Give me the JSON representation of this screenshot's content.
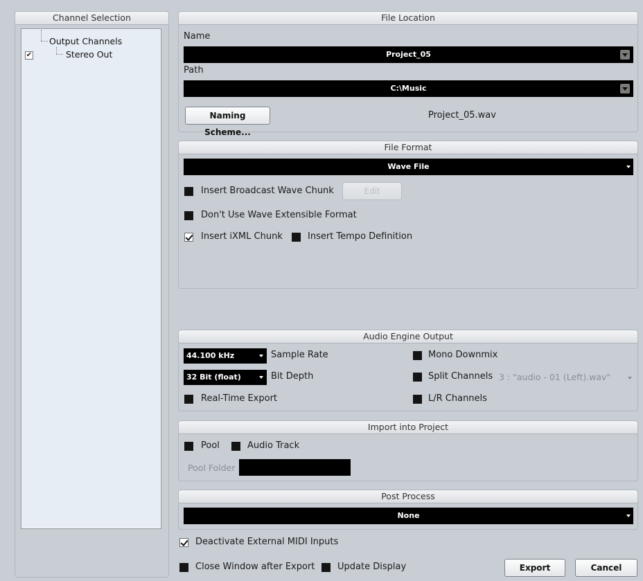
{
  "channel_selection": {
    "title": "Channel Selection",
    "tree": [
      {
        "label": "Output Channels",
        "checked": false
      },
      {
        "label": "Stereo Out",
        "checked": true
      }
    ]
  },
  "file_location": {
    "title": "File Location",
    "name_label": "Name",
    "name_value": "Project_05",
    "path_label": "Path",
    "path_value": "C:\\Music",
    "naming_scheme_button": "Naming Scheme...",
    "file_preview": "Project_05.wav"
  },
  "file_format": {
    "title": "File Format",
    "format_value": "Wave File",
    "broadcast_label": "Insert Broadcast Wave Chunk",
    "broadcast_checked": false,
    "edit_button": "Edit",
    "extensible_label": "Don't Use Wave Extensible Format",
    "extensible_checked": false,
    "ixml_label": "Insert iXML Chunk",
    "ixml_checked": true,
    "tempo_label": "Insert Tempo Definition",
    "tempo_checked": false
  },
  "audio_engine": {
    "title": "Audio Engine Output",
    "sample_rate_value": "44.100 kHz",
    "sample_rate_label": "Sample Rate",
    "bit_depth_value": "32 Bit (float)",
    "bit_depth_label": "Bit Depth",
    "realtime_label": "Real-Time Export",
    "realtime_checked": false,
    "mono_label": "Mono Downmix",
    "mono_checked": false,
    "split_label": "Split Channels",
    "split_checked": false,
    "split_value": "3 : \"audio - 01 (Left).wav\"",
    "lr_label": "L/R Channels",
    "lr_checked": false
  },
  "import_project": {
    "title": "Import into Project",
    "pool_label": "Pool",
    "pool_checked": false,
    "audio_track_label": "Audio Track",
    "audio_track_checked": false,
    "pool_folder_label": "Pool Folder",
    "pool_folder_value": ""
  },
  "post_process": {
    "title": "Post Process",
    "value": "None"
  },
  "bottom": {
    "deactivate_midi_label": "Deactivate External MIDI Inputs",
    "deactivate_midi_checked": true,
    "close_window_label": "Close Window after Export",
    "close_window_checked": false,
    "update_display_label": "Update Display",
    "update_display_checked": false,
    "export_button": "Export",
    "cancel_button": "Cancel"
  }
}
